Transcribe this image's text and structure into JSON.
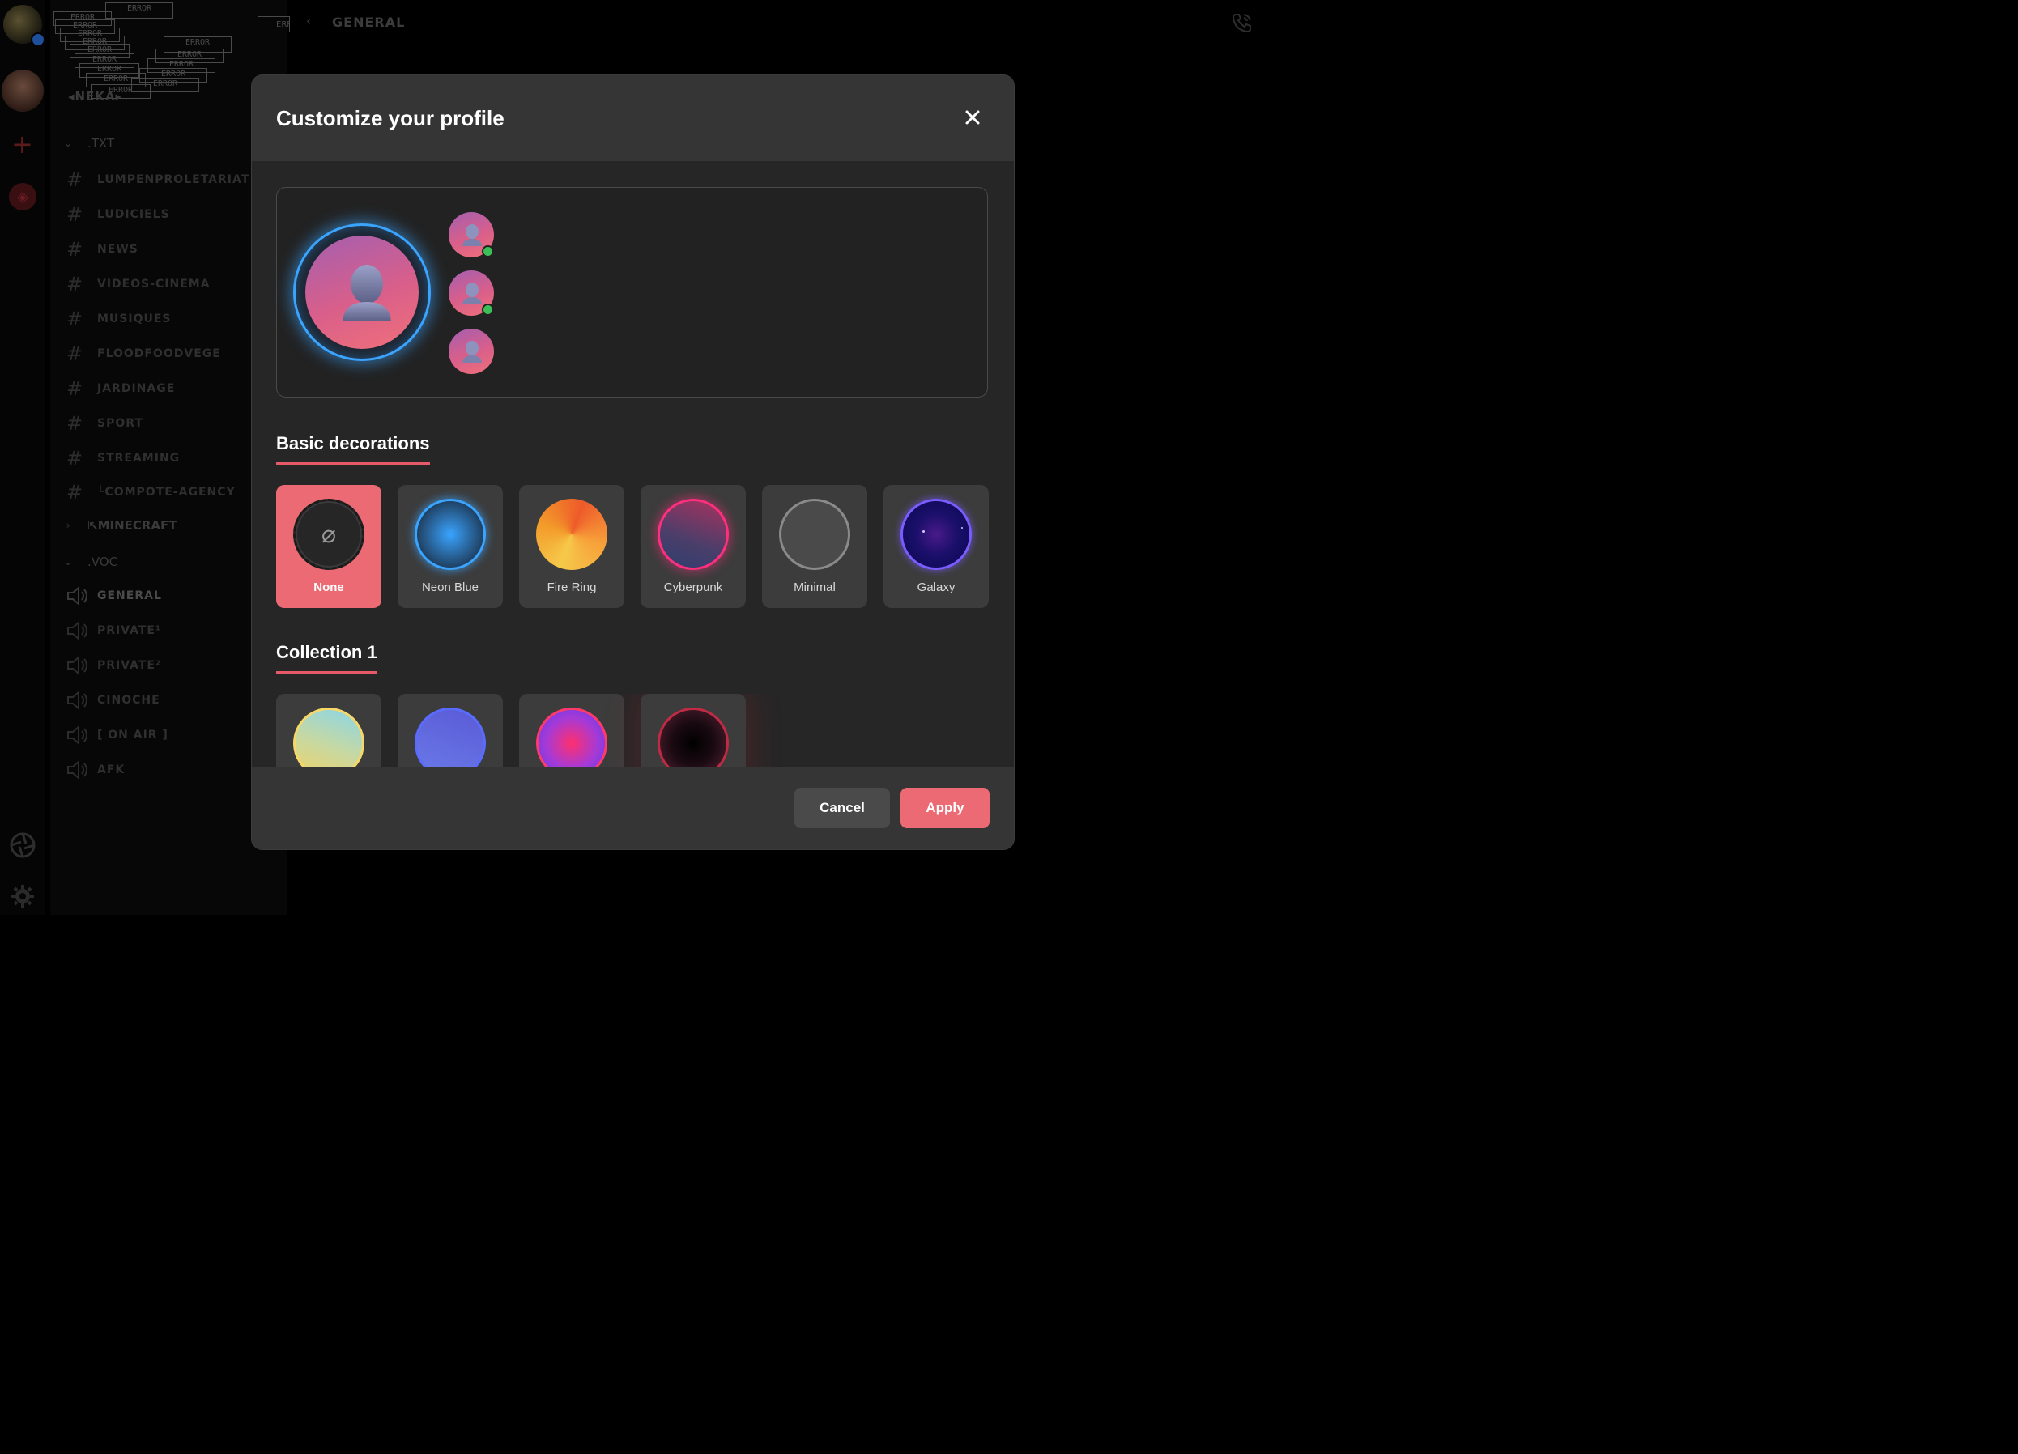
{
  "server": {
    "name": "◂NEKA▸"
  },
  "error_label": "ERROR",
  "topbar": {
    "back": "‹",
    "title": "GENERAL"
  },
  "sidebar": {
    "categories": [
      {
        "label": ".TXT",
        "chevron": "⌄"
      },
      {
        "label": "⇱MINECRAFT",
        "chevron": "›"
      },
      {
        "label": ".VOC",
        "chevron": "⌄"
      }
    ],
    "text_channels": [
      "LUMPENPROLETARIAT",
      "LUDICIELS",
      "NEWS",
      "VIDEOS-CINEMA",
      "MUSIQUES",
      "FLOODFOODVEGE",
      "JARDINAGE",
      "SPORT",
      "STREAMING",
      "└COMPOTE-AGENCY"
    ],
    "voice_channels": [
      "GENERAL",
      "PRIVATE¹",
      "PRIVATE²",
      "CINOCHE",
      "[ ON AIR ]",
      "AFK"
    ]
  },
  "modal": {
    "title": "Customize your profile",
    "close_glyph": "✕",
    "basic_title": "Basic decorations",
    "collection_title": "Collection 1",
    "none_glyph": "⌀",
    "decorations": [
      {
        "label": "None",
        "selected": true
      },
      {
        "label": "Neon Blue",
        "selected": false
      },
      {
        "label": "Fire Ring",
        "selected": false
      },
      {
        "label": "Cyberpunk",
        "selected": false
      },
      {
        "label": "Minimal",
        "selected": false
      },
      {
        "label": "Galaxy",
        "selected": false
      }
    ],
    "cancel_label": "Cancel",
    "apply_label": "Apply"
  },
  "colors": {
    "accent": "#ec6a73",
    "online": "#3dbf58",
    "neon_blue": "#3aa4ff"
  }
}
